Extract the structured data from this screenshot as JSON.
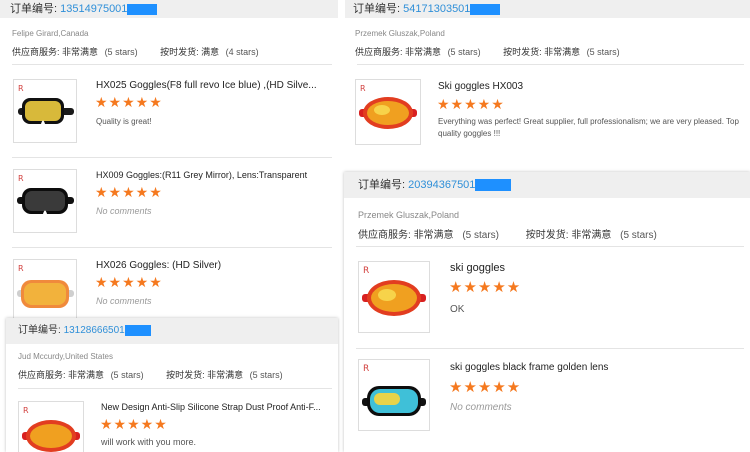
{
  "labels": {
    "order_no": "订单编号:",
    "supplier_service": "供应商服务:",
    "on_time_shipping": "按时发货:"
  },
  "panel_a": {
    "order_number": "13514975001",
    "buyer": "Felipe Girard,Canada",
    "service_value": "非常满意",
    "service_stars": "(5 stars)",
    "shipping_value": "满意",
    "shipping_stars": "(4 stars)",
    "items": [
      {
        "title": "HX025 Goggles(F8 full revo Ice blue) ,(HD Silve...",
        "stars": "★★★★★",
        "review": "Quality is great!"
      },
      {
        "title": "HX009 Goggles:(R11 Grey Mirror), Lens:Transparent",
        "stars": "★★★★★",
        "review": "No comments"
      },
      {
        "title": "HX026 Goggles: (HD Silver)",
        "stars": "★★★★★",
        "review": "No comments"
      }
    ]
  },
  "panel_b": {
    "order_number": "54171303501",
    "buyer": "Przemek Gluszak,Poland",
    "service_value": "非常满意",
    "service_stars": "(5 stars)",
    "shipping_value": "非常满意",
    "shipping_stars": "(5 stars)",
    "items": [
      {
        "title": "Ski goggles HX003",
        "stars": "★★★★★",
        "review": "Everything was perfect! Great supplier, full professionalism; we are very pleased. Top quality goggles !!!"
      }
    ]
  },
  "panel_c": {
    "order_number": "20394367501",
    "buyer": "Przemek Gluszak,Poland",
    "service_value": "非常满意",
    "service_stars": "(5 stars)",
    "shipping_value": "非常满意",
    "shipping_stars": "(5 stars)",
    "items": [
      {
        "title": "ski goggles",
        "stars": "★★★★★",
        "review": "OK"
      },
      {
        "title": "ski goggles black frame golden lens",
        "stars": "★★★★★",
        "review": "No comments"
      }
    ]
  },
  "panel_d": {
    "order_number": "13128666501",
    "buyer": "Jud Mccurdy,United States",
    "service_value": "非常满意",
    "service_stars": "(5 stars)",
    "shipping_value": "非常满意",
    "shipping_stars": "(5 stars)",
    "items": [
      {
        "title": "New Design Anti-Slip Silicone Strap Dust Proof Anti-F...",
        "stars": "★★★★★",
        "review": "will work with you more."
      }
    ]
  },
  "thumb_brand": "R",
  "colors": {
    "accent": "#f5791f",
    "link": "#2f8fd8",
    "mask": "#1e90ff",
    "header_bg": "#efefef"
  }
}
